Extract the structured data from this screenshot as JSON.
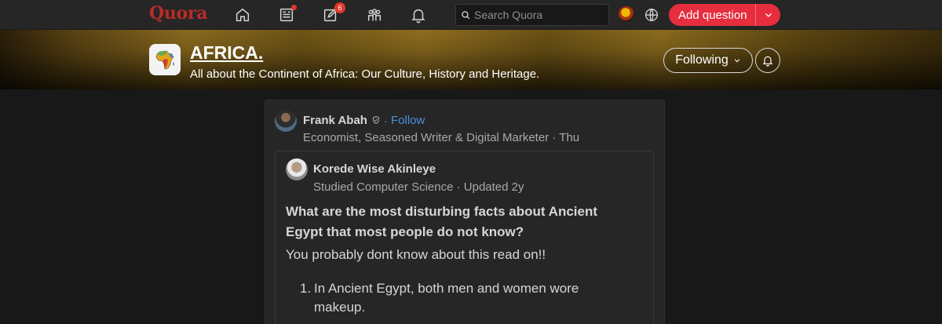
{
  "nav": {
    "logo": "Quora",
    "notifications_count": "6",
    "search_placeholder": "Search Quora",
    "add_question_label": "Add question"
  },
  "space": {
    "title": "AFRICA.",
    "description": "All about the Continent of Africa: Our Culture, History and Heritage.",
    "following_label": "Following"
  },
  "post": {
    "author_name": "Frank Abah",
    "follow_label": "Follow",
    "separator": "·",
    "author_credential": "Economist, Seasoned Writer & Digital Marketer · Thu",
    "shared": {
      "author_name": "Korede Wise Akinleye",
      "author_credential": "Studied Computer Science · Updated 2y",
      "question": "What are the most disturbing facts about Ancient Egypt that most people do not know?",
      "intro": "You probably dont know about this read on!!",
      "list": [
        {
          "number": "1.",
          "text": "In Ancient Egypt, both men and women wore makeup."
        }
      ]
    }
  },
  "colors": {
    "brand": "#b92b27",
    "accent_button": "#e62e3e",
    "link": "#4e8fdb",
    "background": "#181818",
    "card": "#262626"
  },
  "icons": [
    "home-icon",
    "following-feed-icon",
    "answer-icon",
    "spaces-icon",
    "bell-icon",
    "search-icon",
    "globe-icon",
    "chevron-down-icon",
    "verified-icon",
    "africa-map-icon"
  ]
}
